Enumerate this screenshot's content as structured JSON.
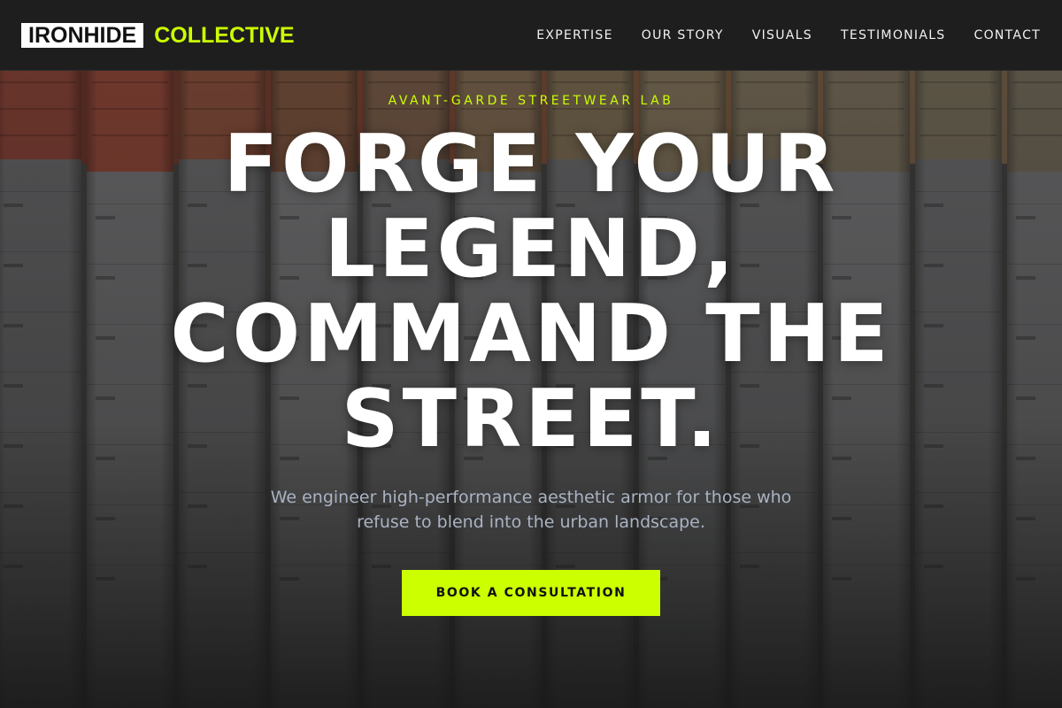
{
  "brand": {
    "name_primary": "IRONHIDE",
    "name_secondary": "COLLECTIVE",
    "accent_color": "#ccff00"
  },
  "nav": {
    "items": [
      {
        "label": "EXPERTISE"
      },
      {
        "label": "OUR STORY"
      },
      {
        "label": "VISUALS"
      },
      {
        "label": "TESTIMONIALS"
      },
      {
        "label": "CONTACT"
      }
    ]
  },
  "hero": {
    "eyebrow": "AVANT-GARDE STREETWEAR LAB",
    "headline": "FORGE YOUR LEGEND, COMMAND THE STREET.",
    "subtext": "We engineer high-performance aesthetic armor for those who refuse to blend into the urban landscape.",
    "cta_label": "BOOK A CONSULTATION",
    "background": "rows of stacked product boxes in warm red, tan and white tones"
  }
}
